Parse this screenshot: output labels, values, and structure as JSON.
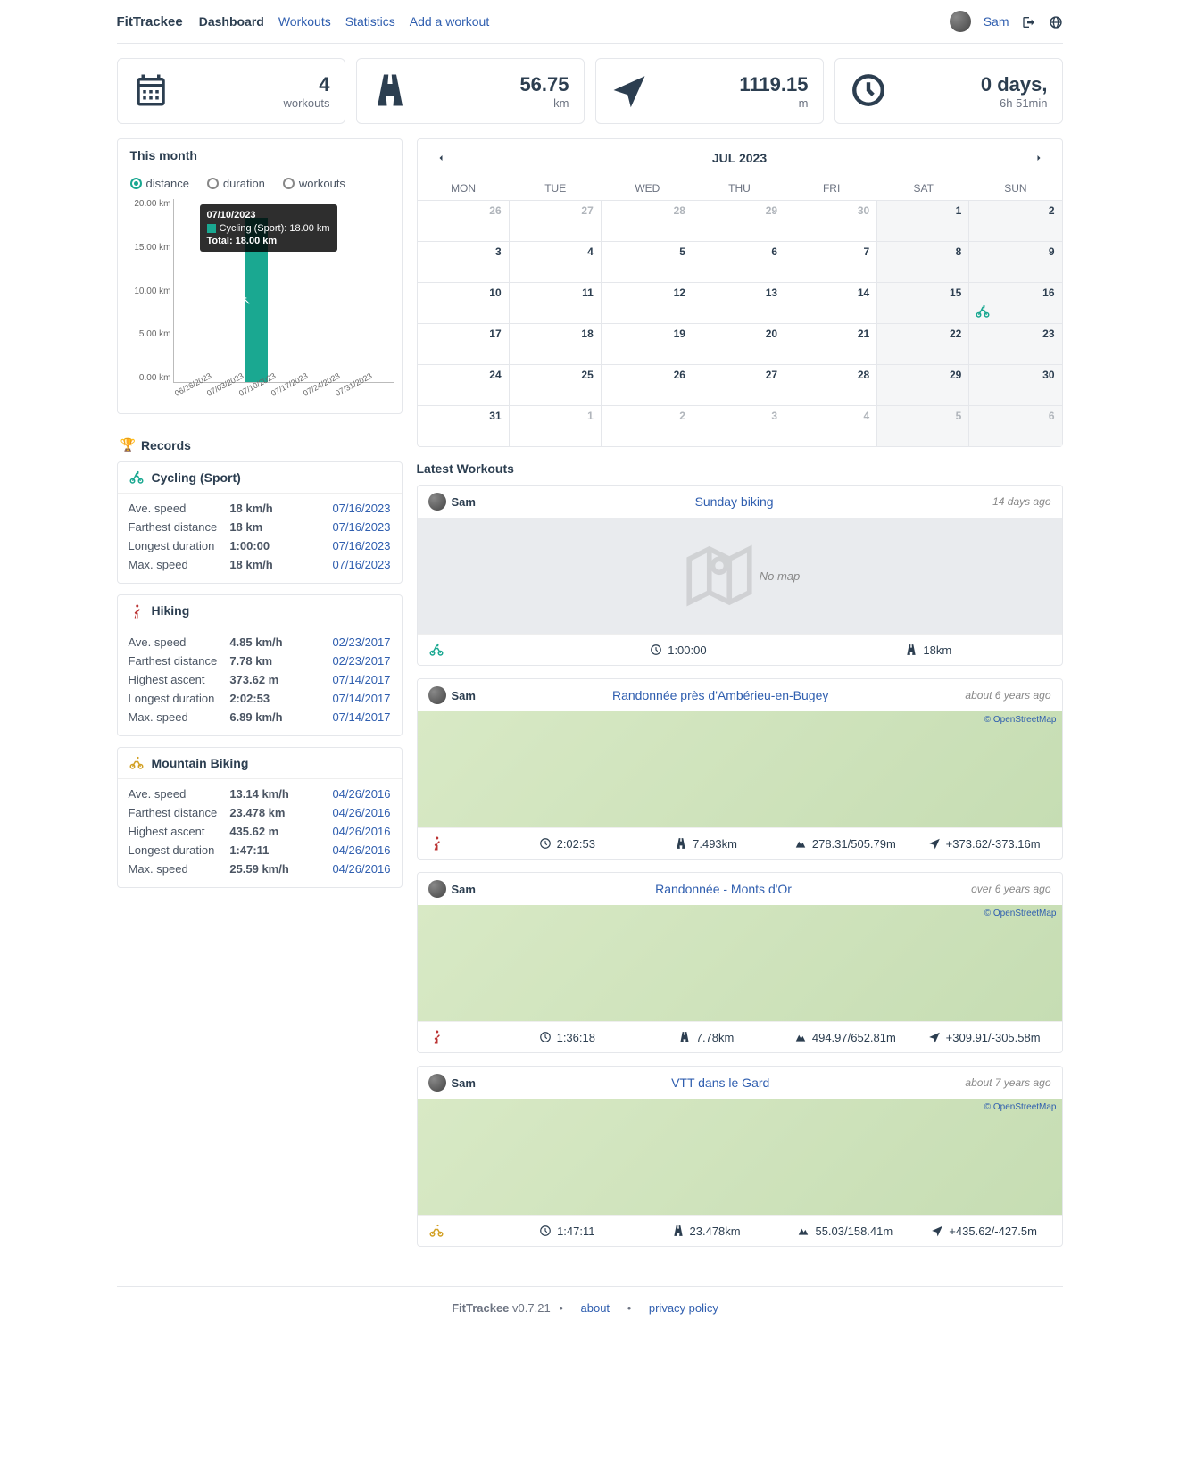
{
  "nav": {
    "brand": "FitTrackee",
    "links": [
      "Dashboard",
      "Workouts",
      "Statistics",
      "Add a workout"
    ],
    "user": "Sam"
  },
  "stats": {
    "workouts": {
      "value": "4",
      "unit": "workouts"
    },
    "distance": {
      "value": "56.75",
      "unit": "km"
    },
    "elevation": {
      "value": "1119.15",
      "unit": "m"
    },
    "duration": {
      "value": "0 days,",
      "unit": "6h 51min"
    }
  },
  "chart": {
    "title": "This month",
    "options": [
      "distance",
      "duration",
      "workouts"
    ],
    "selected": "distance",
    "tooltip": {
      "date": "07/10/2023",
      "series": "Cycling (Sport): 18.00 km",
      "total": "Total: 18.00 km"
    }
  },
  "chart_data": {
    "type": "bar",
    "categories": [
      "06/26/2023",
      "07/03/2023",
      "07/10/2023",
      "07/17/2023",
      "07/24/2023",
      "07/31/2023"
    ],
    "values": [
      0,
      0,
      18.0,
      0,
      0,
      0
    ],
    "ylabel": "km",
    "ylim": [
      0,
      20
    ],
    "series": [
      {
        "name": "Cycling (Sport)",
        "values": [
          0,
          0,
          18.0,
          0,
          0,
          0
        ]
      }
    ]
  },
  "records_heading": "Records",
  "records": [
    {
      "sport": "Cycling (Sport)",
      "icon": "cycling",
      "rows": [
        {
          "label": "Ave. speed",
          "value": "18 km/h",
          "date": "07/16/2023"
        },
        {
          "label": "Farthest distance",
          "value": "18 km",
          "date": "07/16/2023"
        },
        {
          "label": "Longest duration",
          "value": "1:00:00",
          "date": "07/16/2023"
        },
        {
          "label": "Max. speed",
          "value": "18 km/h",
          "date": "07/16/2023"
        }
      ]
    },
    {
      "sport": "Hiking",
      "icon": "hiking",
      "rows": [
        {
          "label": "Ave. speed",
          "value": "4.85 km/h",
          "date": "02/23/2017"
        },
        {
          "label": "Farthest distance",
          "value": "7.78 km",
          "date": "02/23/2017"
        },
        {
          "label": "Highest ascent",
          "value": "373.62 m",
          "date": "07/14/2017"
        },
        {
          "label": "Longest duration",
          "value": "2:02:53",
          "date": "07/14/2017"
        },
        {
          "label": "Max. speed",
          "value": "6.89 km/h",
          "date": "07/14/2017"
        }
      ]
    },
    {
      "sport": "Mountain Biking",
      "icon": "mtb",
      "rows": [
        {
          "label": "Ave. speed",
          "value": "13.14 km/h",
          "date": "04/26/2016"
        },
        {
          "label": "Farthest distance",
          "value": "23.478 km",
          "date": "04/26/2016"
        },
        {
          "label": "Highest ascent",
          "value": "435.62 m",
          "date": "04/26/2016"
        },
        {
          "label": "Longest duration",
          "value": "1:47:11",
          "date": "04/26/2016"
        },
        {
          "label": "Max. speed",
          "value": "25.59 km/h",
          "date": "04/26/2016"
        }
      ]
    }
  ],
  "calendar": {
    "title": "JUL 2023",
    "dow": [
      "MON",
      "TUE",
      "WED",
      "THU",
      "FRI",
      "SAT",
      "SUN"
    ],
    "cells": [
      {
        "n": 26,
        "other": true
      },
      {
        "n": 27,
        "other": true
      },
      {
        "n": 28,
        "other": true
      },
      {
        "n": 29,
        "other": true
      },
      {
        "n": 30,
        "other": true
      },
      {
        "n": 1,
        "wknd": true
      },
      {
        "n": 2,
        "wknd": true
      },
      {
        "n": 3
      },
      {
        "n": 4
      },
      {
        "n": 5
      },
      {
        "n": 6
      },
      {
        "n": 7
      },
      {
        "n": 8,
        "wknd": true
      },
      {
        "n": 9,
        "wknd": true
      },
      {
        "n": 10
      },
      {
        "n": 11
      },
      {
        "n": 12
      },
      {
        "n": 13
      },
      {
        "n": 14
      },
      {
        "n": 15,
        "wknd": true
      },
      {
        "n": 16,
        "wknd": true,
        "workout": "cycling"
      },
      {
        "n": 17
      },
      {
        "n": 18
      },
      {
        "n": 19
      },
      {
        "n": 20
      },
      {
        "n": 21
      },
      {
        "n": 22,
        "wknd": true
      },
      {
        "n": 23,
        "wknd": true
      },
      {
        "n": 24
      },
      {
        "n": 25
      },
      {
        "n": 26
      },
      {
        "n": 27
      },
      {
        "n": 28
      },
      {
        "n": 29,
        "wknd": true
      },
      {
        "n": 30,
        "wknd": true
      },
      {
        "n": 31
      },
      {
        "n": 1,
        "other": true
      },
      {
        "n": 2,
        "other": true
      },
      {
        "n": 3,
        "other": true
      },
      {
        "n": 4,
        "other": true
      },
      {
        "n": 5,
        "other": true,
        "wknd": true
      },
      {
        "n": 6,
        "other": true,
        "wknd": true
      }
    ],
    "osm_attrib": "© OpenStreetMap"
  },
  "latest_title": "Latest Workouts",
  "no_map_label": "No map",
  "workouts": [
    {
      "user": "Sam",
      "title": "Sunday biking",
      "age": "14 days ago",
      "map": "none",
      "sport": "cycling",
      "stats": [
        {
          "icon": "clock",
          "text": "1:00:00"
        },
        {
          "icon": "road",
          "text": "18km"
        }
      ]
    },
    {
      "user": "Sam",
      "title": "Randonnée près d'Ambérieu-en-Bugey",
      "age": "about 6 years ago",
      "map": "osm",
      "sport": "hiking",
      "stats": [
        {
          "icon": "clock",
          "text": "2:02:53"
        },
        {
          "icon": "road",
          "text": "7.493km"
        },
        {
          "icon": "mountain",
          "text": "278.31/505.79m"
        },
        {
          "icon": "arrow",
          "text": "+373.62/-373.16m"
        }
      ]
    },
    {
      "user": "Sam",
      "title": "Randonnée - Monts d'Or",
      "age": "over 6 years ago",
      "map": "osm",
      "sport": "hiking",
      "stats": [
        {
          "icon": "clock",
          "text": "1:36:18"
        },
        {
          "icon": "road",
          "text": "7.78km"
        },
        {
          "icon": "mountain",
          "text": "494.97/652.81m"
        },
        {
          "icon": "arrow",
          "text": "+309.91/-305.58m"
        }
      ]
    },
    {
      "user": "Sam",
      "title": "VTT dans le Gard",
      "age": "about 7 years ago",
      "map": "osm",
      "sport": "mtb",
      "stats": [
        {
          "icon": "clock",
          "text": "1:47:11"
        },
        {
          "icon": "road",
          "text": "23.478km"
        },
        {
          "icon": "mountain",
          "text": "55.03/158.41m"
        },
        {
          "icon": "arrow",
          "text": "+435.62/-427.5m"
        }
      ]
    }
  ],
  "footer": {
    "brand": "FitTrackee",
    "version": "v0.7.21",
    "links": [
      "about",
      "privacy policy"
    ]
  }
}
